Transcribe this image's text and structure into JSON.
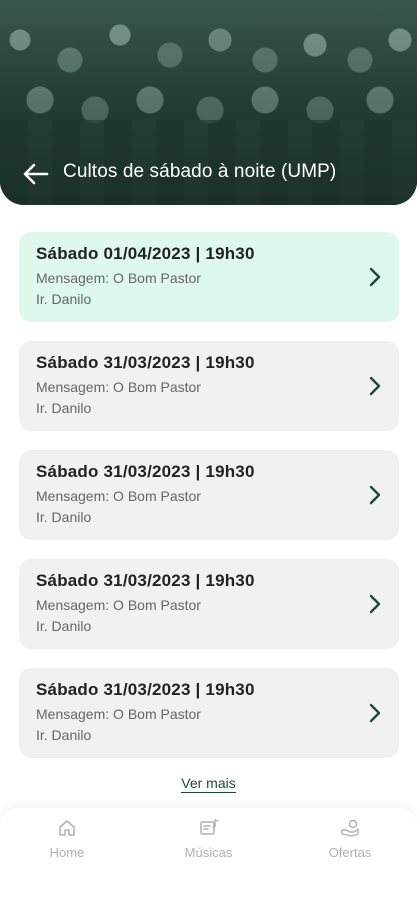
{
  "header": {
    "title": "Cultos de sábado à noite (UMP)",
    "back_icon": "arrow-left-icon"
  },
  "services": [
    {
      "date": "Sábado 01/04/2023 | 19h30",
      "message": "Mensagem: O Bom Pastor",
      "speaker": "Ir. Danilo",
      "highlighted": true
    },
    {
      "date": "Sábado 31/03/2023 | 19h30",
      "message": "Mensagem: O Bom Pastor",
      "speaker": "Ir. Danilo",
      "highlighted": false
    },
    {
      "date": "Sábado 31/03/2023 | 19h30",
      "message": "Mensagem: O Bom Pastor",
      "speaker": "Ir. Danilo",
      "highlighted": false
    },
    {
      "date": "Sábado 31/03/2023 | 19h30",
      "message": "Mensagem: O Bom Pastor",
      "speaker": "Ir. Danilo",
      "highlighted": false
    },
    {
      "date": "Sábado 31/03/2023 | 19h30",
      "message": "Mensagem: O Bom Pastor",
      "speaker": "Ir. Danilo",
      "highlighted": false
    }
  ],
  "see_more": "Ver mais",
  "nav": {
    "items": [
      {
        "label": "Home",
        "icon": "home-icon"
      },
      {
        "label": "Músicas",
        "icon": "music-icon"
      },
      {
        "label": "Ofertas",
        "icon": "offerings-icon"
      }
    ]
  },
  "colors": {
    "accent": "#1c4a36",
    "highlight_card": "#def8ec",
    "card": "#f1f1f1",
    "nav_inactive": "#b0b0b0"
  }
}
